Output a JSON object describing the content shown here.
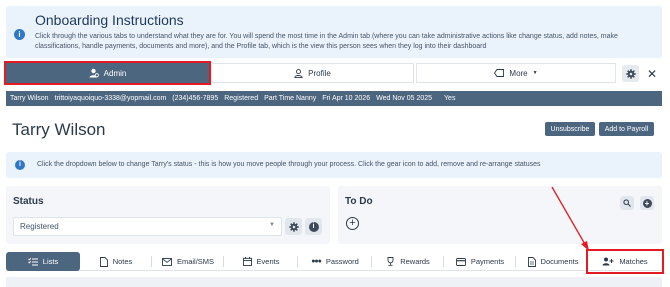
{
  "onboarding": {
    "title": "Onboarding Instructions",
    "description": "Click through the various tabs to understand what they are for. You will spend the most time in the Admin tab (where you can take administrative actions like change status, add notes, make classifications, handle payments, documents and more), and the Profile tab, which is the view this person sees when they log into their dashboard"
  },
  "top_tabs": {
    "admin": "Admin",
    "profile": "Profile",
    "more": "More"
  },
  "user_bar": {
    "name": "Tarry Wilson",
    "email": "trittoiyaquoiquo-3338@yopmail.com",
    "phone": "(234)456-7895",
    "status": "Registered",
    "type": "Part Time Nanny",
    "date1": "Fri Apr 10 2026",
    "date2": "Wed Nov 05 2025",
    "flag": "Yes"
  },
  "header": {
    "name": "Tarry Wilson",
    "unsubscribe": "Unsubscribe",
    "add_to_payroll": "Add to Payroll"
  },
  "status_info": "Click the dropdown below to change Tarry's status - this is how you move people through your process. Click the gear icon to add, remove and re-arrange statuses",
  "status_card": {
    "heading": "Status",
    "selected": "Registered"
  },
  "todo_card": {
    "heading": "To Do"
  },
  "bottom_tabs": [
    "Lists",
    "Notes",
    "Email/SMS",
    "Events",
    "Password",
    "Rewards",
    "Payments",
    "Documents",
    "Matches"
  ],
  "colors": {
    "primary": "#4d6680",
    "highlight": "#e31b23",
    "info_bg": "#eaf2fb"
  }
}
